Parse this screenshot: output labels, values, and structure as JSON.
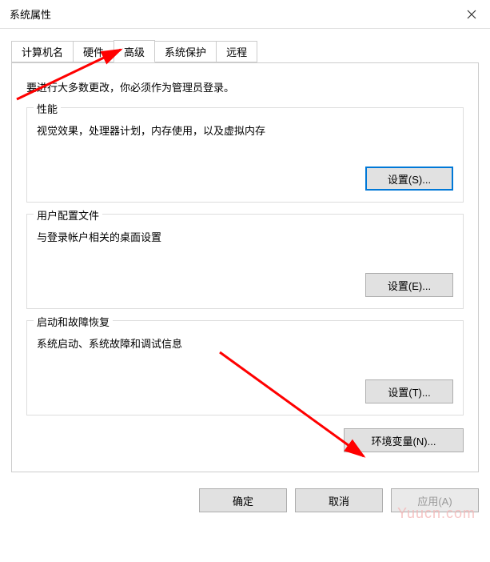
{
  "window": {
    "title": "系统属性"
  },
  "tabs": {
    "computerName": "计算机名",
    "hardware": "硬件",
    "advanced": "高级",
    "systemProtection": "系统保护",
    "remote": "远程"
  },
  "intro": "要进行大多数更改，你必须作为管理员登录。",
  "performance": {
    "title": "性能",
    "description": "视觉效果，处理器计划，内存使用，以及虚拟内存",
    "button": "设置(S)..."
  },
  "userProfiles": {
    "title": "用户配置文件",
    "description": "与登录帐户相关的桌面设置",
    "button": "设置(E)..."
  },
  "startup": {
    "title": "启动和故障恢复",
    "description": "系统启动、系统故障和调试信息",
    "button": "设置(T)..."
  },
  "envVarButton": "环境变量(N)...",
  "buttons": {
    "ok": "确定",
    "cancel": "取消",
    "apply": "应用(A)"
  },
  "watermark": "Yuucn.com"
}
